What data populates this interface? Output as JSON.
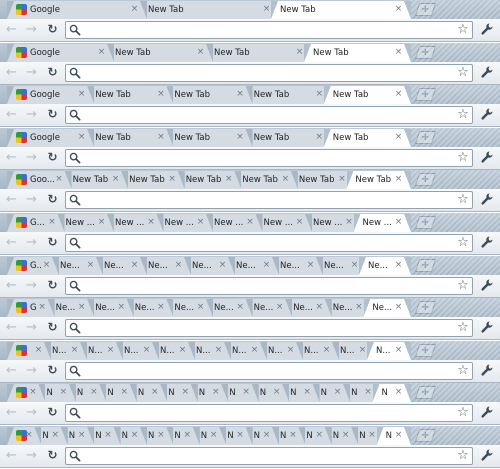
{
  "colors": {
    "tabstrip": "#a9b8c6",
    "inactive_tab": "#d4dbe3",
    "active_tab": "#ffffff",
    "toolbar": "#e4e9ee",
    "omnibox_border": "#93a2b1"
  },
  "icons": {
    "back": "back-arrow-icon",
    "forward": "forward-arrow-icon",
    "reload": "reload-icon",
    "search": "search-icon",
    "star": "bookmark-star-icon",
    "wrench": "wrench-icon",
    "favicon": "google-favicon-icon",
    "close": "close-icon",
    "new_tab": "plus-icon"
  },
  "toolbar": {
    "back_glyph": "←",
    "forward_glyph": "→",
    "reload_glyph": "↻",
    "star_glyph": "☆",
    "address_value": ""
  },
  "new_tab_glyph": "+",
  "close_glyph": "×",
  "windows": [
    {
      "tabs": [
        "Google",
        "New Tab",
        "New Tab"
      ],
      "active": 2
    },
    {
      "tabs": [
        "Google",
        "New Tab",
        "New Tab",
        "New Tab"
      ],
      "active": 3
    },
    {
      "tabs": [
        "Google",
        "New Tab",
        "New Tab",
        "New Tab",
        "New Tab"
      ],
      "active": 4
    },
    {
      "tabs": [
        "Google",
        "New Tab",
        "New Tab",
        "New Tab",
        "New Tab"
      ],
      "active": 4
    },
    {
      "tabs": [
        "Goo...",
        "New Tab",
        "New Tab",
        "New Tab",
        "New Tab",
        "New Tab",
        "New Tab"
      ],
      "active": 6
    },
    {
      "tabs": [
        "G...",
        "New ...",
        "New ...",
        "New ...",
        "New ...",
        "New ...",
        "New ...",
        "New ..."
      ],
      "active": 7
    },
    {
      "tabs": [
        "G...",
        "Ne...",
        "Ne...",
        "Ne...",
        "Ne...",
        "Ne...",
        "Ne...",
        "Ne...",
        "Ne..."
      ],
      "active": 8
    },
    {
      "tabs": [
        "G",
        "Ne...",
        "Ne...",
        "Ne...",
        "Ne...",
        "Ne...",
        "Ne...",
        "Ne...",
        "Ne...",
        "Ne..."
      ],
      "active": 9
    },
    {
      "tabs": [
        "",
        "N...",
        "N...",
        "N...",
        "N...",
        "N...",
        "N...",
        "N...",
        "N...",
        "N...",
        "N..."
      ],
      "active": 10
    },
    {
      "tabs": [
        "",
        "N",
        "N",
        "N",
        "N",
        "N",
        "N",
        "N",
        "N",
        "N",
        "N",
        "N",
        "N"
      ],
      "active": 12
    },
    {
      "tabs": [
        "",
        "N",
        "N",
        "N",
        "N",
        "N",
        "N",
        "N",
        "N",
        "N",
        "N",
        "N",
        "N",
        "N",
        "N"
      ],
      "active": 14
    }
  ]
}
